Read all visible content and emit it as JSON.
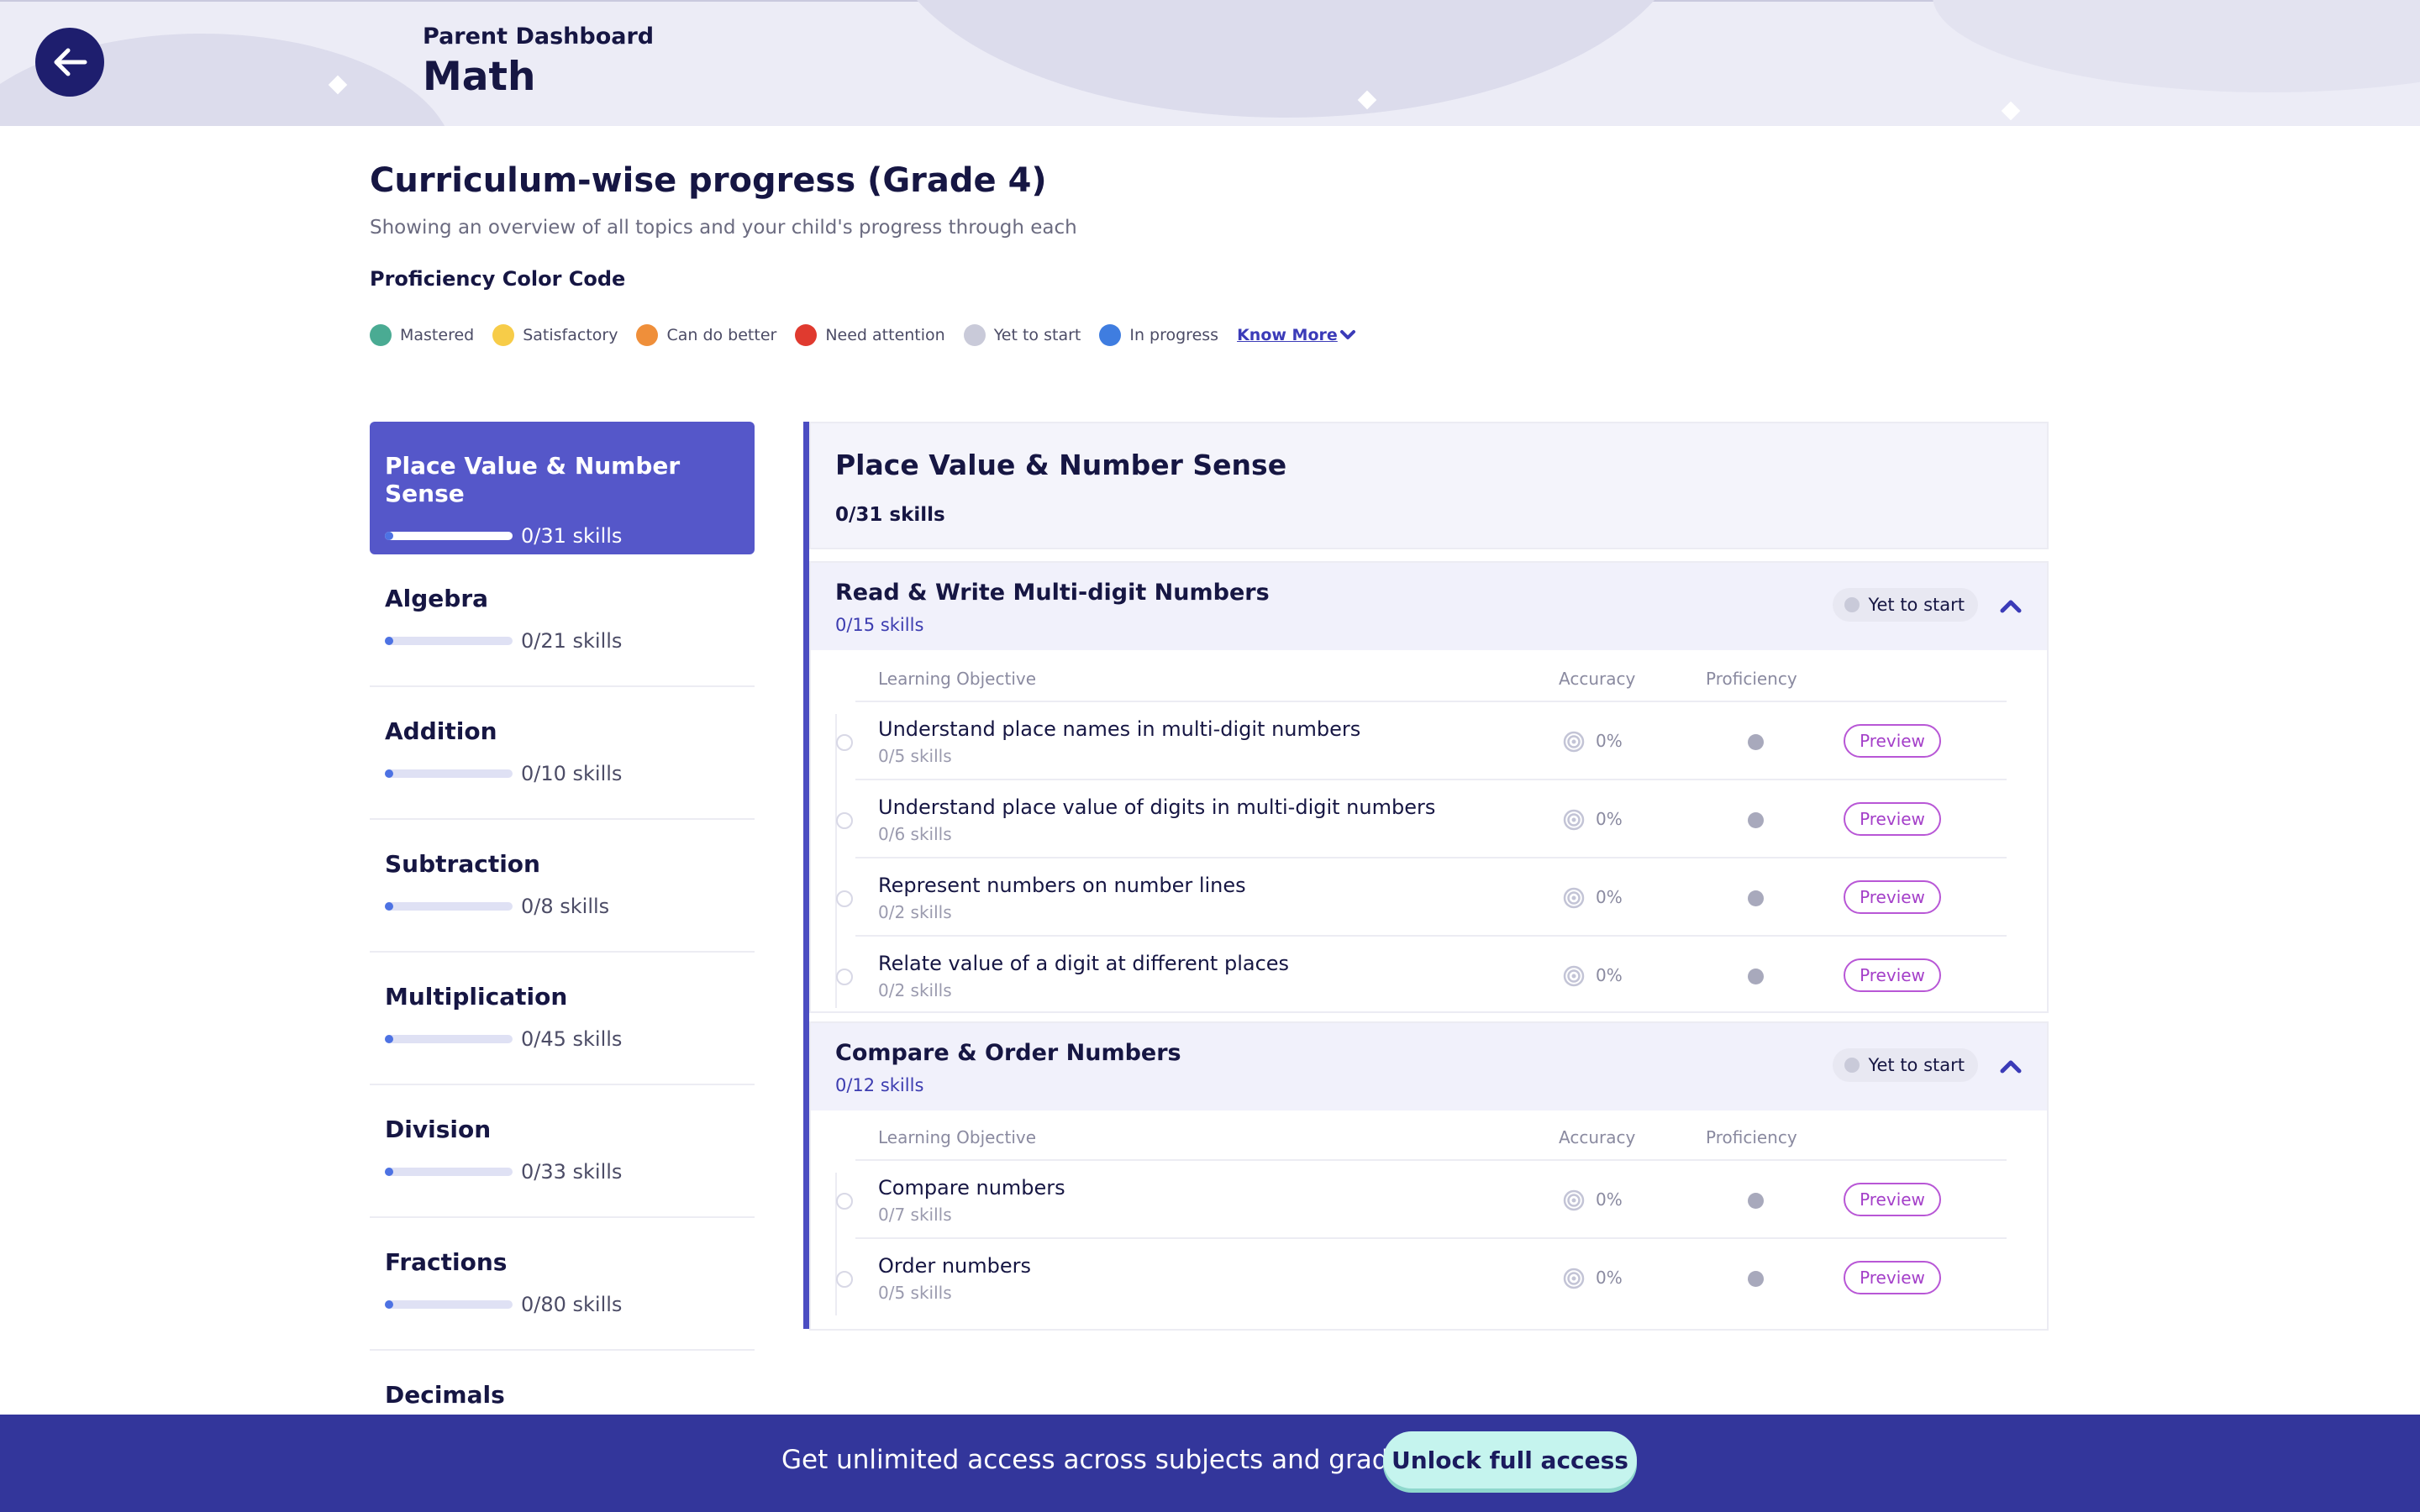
{
  "header": {
    "subtitle": "Parent Dashboard",
    "title": "Math"
  },
  "page": {
    "title": "Curriculum-wise progress (Grade 4)",
    "subtitle": "Showing an overview of all topics and your child's progress through each",
    "color_code_label": "Proficiency Color Code"
  },
  "legend": {
    "items": [
      {
        "label": "Mastered",
        "color": "#4aab93"
      },
      {
        "label": "Satisfactory",
        "color": "#f7cc48"
      },
      {
        "label": "Can do better",
        "color": "#ef8f3a"
      },
      {
        "label": "Need attention",
        "color": "#e03a2f"
      },
      {
        "label": "Yet to start",
        "color": "#c9cad9"
      },
      {
        "label": "In progress",
        "color": "#3f7de0"
      }
    ],
    "know_more": "Know More"
  },
  "sidebar": {
    "topics": [
      {
        "name": "Place Value & Number Sense",
        "count": "0/31 skills",
        "progress": 0
      },
      {
        "name": "Algebra",
        "count": "0/21 skills",
        "progress": 0
      },
      {
        "name": "Addition",
        "count": "0/10 skills",
        "progress": 0
      },
      {
        "name": "Subtraction",
        "count": "0/8 skills",
        "progress": 0
      },
      {
        "name": "Multiplication",
        "count": "0/45 skills",
        "progress": 0
      },
      {
        "name": "Division",
        "count": "0/33 skills",
        "progress": 0
      },
      {
        "name": "Fractions",
        "count": "0/80 skills",
        "progress": 0
      },
      {
        "name": "Decimals"
      }
    ]
  },
  "main": {
    "title": "Place Value & Number Sense",
    "count": "0/31 skills",
    "columns": {
      "objective": "Learning Objective",
      "accuracy": "Accuracy",
      "proficiency": "Proficiency"
    },
    "sections": [
      {
        "title": "Read & Write Multi-digit Numbers",
        "count": "0/15 skills",
        "status": "Yet to start",
        "rows": [
          {
            "title": "Understand place names in multi-digit numbers",
            "sub": "0/5 skills",
            "accuracy": "0%",
            "action": "Preview"
          },
          {
            "title": "Understand place value of digits in multi-digit numbers",
            "sub": "0/6 skills",
            "accuracy": "0%",
            "action": "Preview"
          },
          {
            "title": "Represent numbers on number lines",
            "sub": "0/2 skills",
            "accuracy": "0%",
            "action": "Preview"
          },
          {
            "title": "Relate value of a digit at different places",
            "sub": "0/2 skills",
            "accuracy": "0%",
            "action": "Preview"
          }
        ]
      },
      {
        "title": "Compare & Order Numbers",
        "count": "0/12 skills",
        "status": "Yet to start",
        "rows": [
          {
            "title": "Compare numbers",
            "sub": "0/7 skills",
            "accuracy": "0%",
            "action": "Preview"
          },
          {
            "title": "Order numbers",
            "sub": "0/5 skills",
            "accuracy": "0%",
            "action": "Preview"
          }
        ]
      }
    ]
  },
  "banner": {
    "text": "Get unlimited access across subjects and grades.",
    "button": "Unlock full access"
  }
}
